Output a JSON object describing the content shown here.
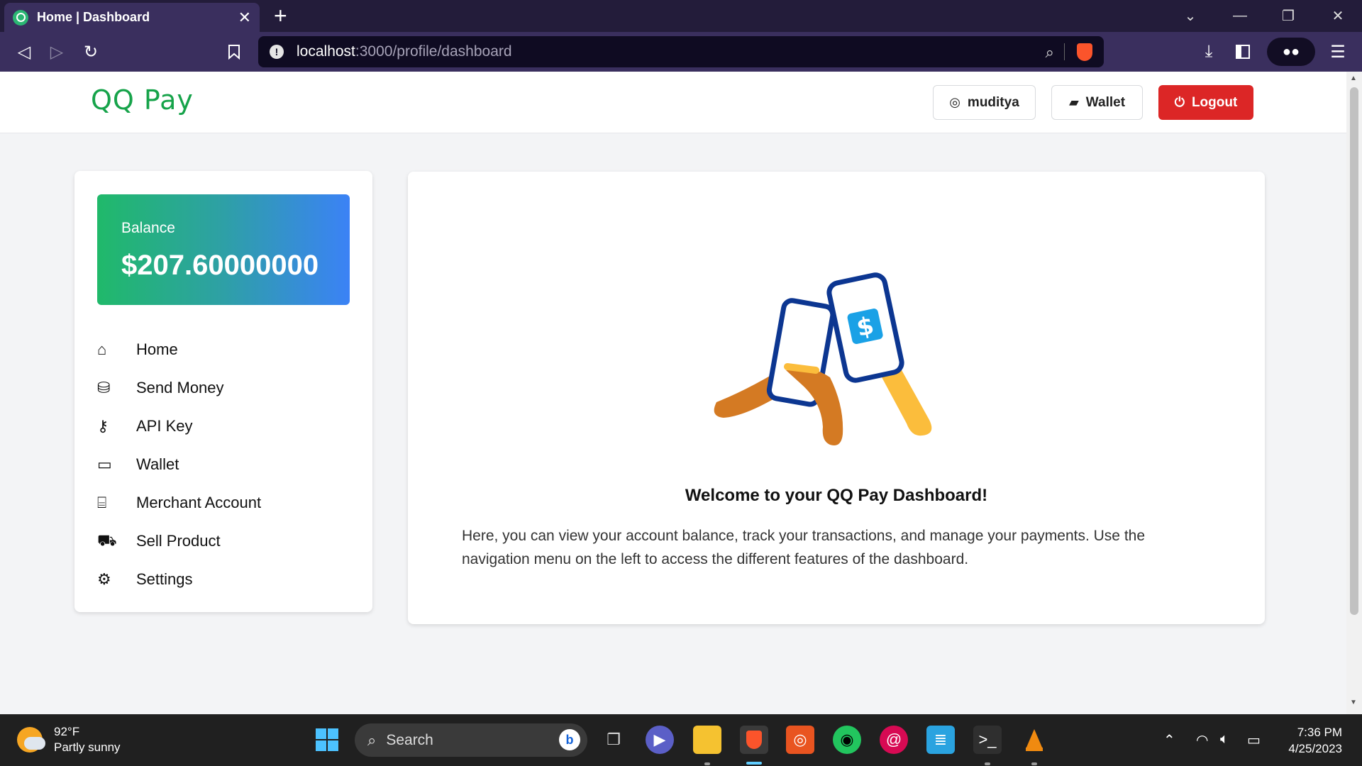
{
  "browser": {
    "tab_title": "Home | Dashboard",
    "url_host": "localhost",
    "url_path": ":3000/profile/dashboard"
  },
  "header": {
    "logo": "QQ Pay",
    "user_label": "muditya",
    "wallet_label": "Wallet",
    "logout_label": "Logout",
    "colors": {
      "brand": "#16a34a",
      "logout": "#dc2626"
    }
  },
  "sidebar": {
    "balance_label": "Balance",
    "balance_amount": "$207.60000000",
    "items": [
      {
        "label": "Home",
        "icon": "home-icon"
      },
      {
        "label": "Send Money",
        "icon": "send-money-icon"
      },
      {
        "label": "API Key",
        "icon": "key-icon"
      },
      {
        "label": "Wallet",
        "icon": "credit-card-icon"
      },
      {
        "label": "Merchant Account",
        "icon": "store-icon"
      },
      {
        "label": "Sell Product",
        "icon": "cart-icon"
      },
      {
        "label": "Settings",
        "icon": "gear-icon"
      }
    ]
  },
  "main": {
    "welcome_title": "Welcome to your QQ Pay Dashboard!",
    "description": "Here, you can view your account balance, track your transactions, and manage your payments. Use the navigation menu on the left to access the different features of the dashboard."
  },
  "taskbar": {
    "weather_temp": "92°F",
    "weather_desc": "Partly sunny",
    "search_placeholder": "Search",
    "time": "7:36 PM",
    "date": "4/25/2023"
  }
}
